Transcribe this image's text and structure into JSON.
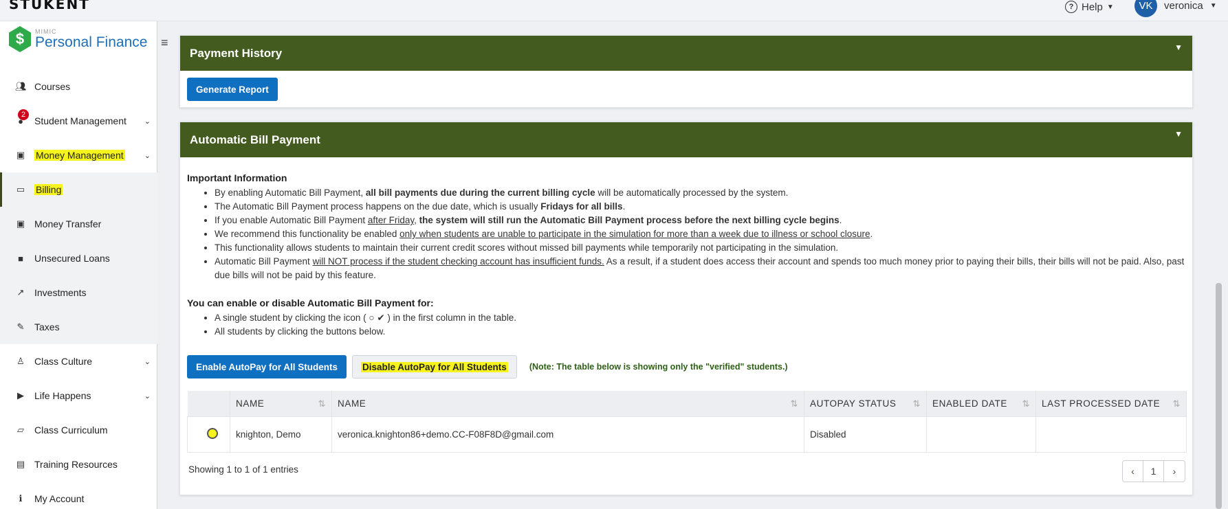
{
  "topbar": {
    "brand": "STUKENT",
    "help_label": "Help",
    "user_initials": "VK",
    "user_name": "veronica"
  },
  "sidebar": {
    "logo_small": "MIMIC",
    "logo_title": "Personal Finance",
    "items": [
      {
        "label": "Courses",
        "icon": "users-icon"
      },
      {
        "label": "Student Management",
        "icon": "user-icon",
        "badge": "2"
      },
      {
        "label": "Money Management",
        "icon": "money-icon",
        "highlighted": true
      },
      {
        "label": "Billing",
        "icon": "credit-card-icon",
        "highlighted": true,
        "active": true
      },
      {
        "label": "Money Transfer",
        "icon": "money-icon"
      },
      {
        "label": "Unsecured Loans",
        "icon": "briefcase-icon"
      },
      {
        "label": "Investments",
        "icon": "line-chart-icon"
      },
      {
        "label": "Taxes",
        "icon": "edit-icon"
      },
      {
        "label": "Class Culture",
        "icon": "person-icon"
      },
      {
        "label": "Life Happens",
        "icon": "play-icon"
      },
      {
        "label": "Class Curriculum",
        "icon": "folder-icon"
      },
      {
        "label": "Training Resources",
        "icon": "document-icon"
      },
      {
        "label": "My Account",
        "icon": "info-icon"
      }
    ]
  },
  "payment_history": {
    "title": "Payment History",
    "generate_label": "Generate Report"
  },
  "autopay": {
    "title": "Automatic Bill Payment",
    "important_heading": "Important Information",
    "b1_a": "By enabling Automatic Bill Payment, ",
    "b1_b": "all bill payments due during the current billing cycle",
    "b1_c": " will be automatically processed by the system.",
    "b2_a": "The Automatic Bill Payment process happens on the due date, which is usually ",
    "b2_b": "Fridays for all bills",
    "b2_c": ".",
    "b3_a": "If you enable Automatic Bill Payment ",
    "b3_b": "after Friday",
    "b3_c": ", ",
    "b3_d": "the system will still run the Automatic Bill Payment process before the next billing cycle begins",
    "b3_e": ".",
    "b4_a": "We recommend this functionality be enabled ",
    "b4_b": "only when students are unable to participate in the simulation for more than a week due to illness or school closure",
    "b4_c": ".",
    "b5": "This functionality allows students to maintain their current credit scores without missed bill payments while temporarily not participating in the simulation.",
    "b6_a": "Automatic Bill Payment ",
    "b6_b": "will NOT process if the student checking account has insufficient funds.",
    "b6_c": " As a result, if a student does access their account and spends too much money prior to paying their bills, their bills will not be paid. Also, past due bills will not be paid by this feature.",
    "enable_heading": "You can enable or disable Automatic Bill Payment for:",
    "e1_a": "A single student by clicking the icon (",
    "e1_b": ") in the first column in the table.",
    "e2": "All students by clicking the buttons below.",
    "enable_all_label": "Enable AutoPay for All Students",
    "disable_all_label": "Disable AutoPay for All Students",
    "note": "(Note: The table below is showing only the \"verified\" students.)"
  },
  "table": {
    "headers": [
      "NAME",
      "NAME",
      "AUTOPAY STATUS",
      "ENABLED DATE",
      "LAST PROCESSED DATE"
    ],
    "rows": [
      {
        "name": "knighton, Demo",
        "email": "veronica.knighton86+demo.CC-F08F8D@gmail.com",
        "status": "Disabled",
        "enabled": "",
        "processed": ""
      }
    ],
    "showing": "Showing 1 to 1 of 1 entries",
    "page": "1"
  },
  "colors": {
    "header_green": "#445b1f",
    "primary_blue": "#0f6fc0",
    "highlight_yellow": "#f7f31c",
    "badge_red": "#d0021b"
  }
}
